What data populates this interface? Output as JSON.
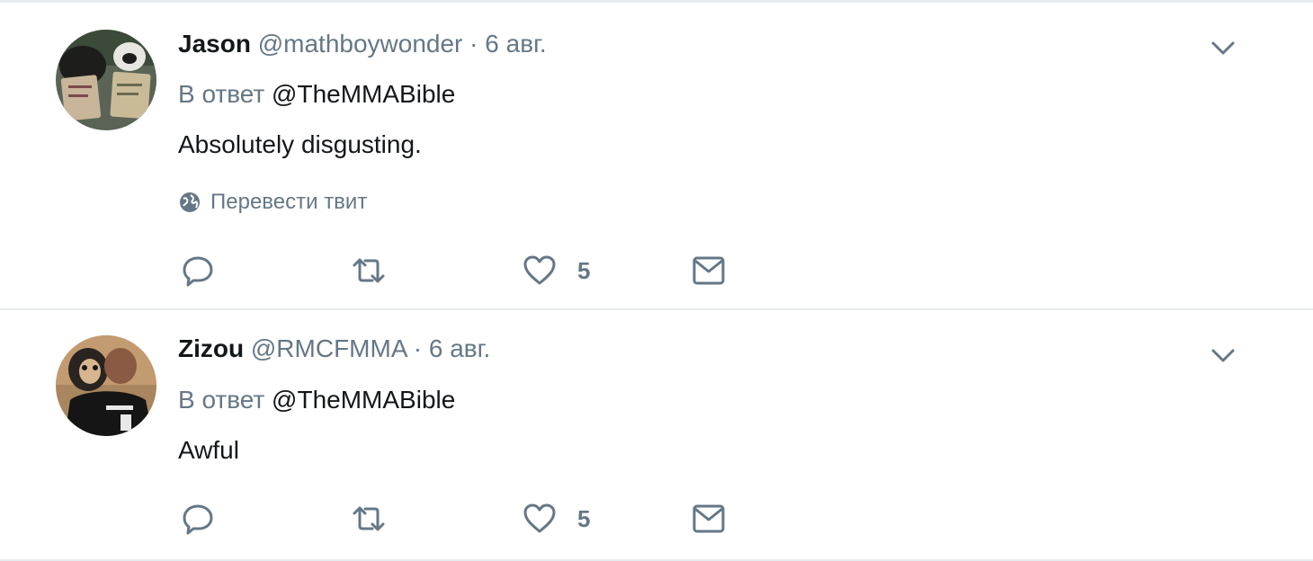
{
  "tweets": [
    {
      "name": "Jason",
      "handle": "@mathboywonder",
      "separator": "·",
      "time": "6 авг.",
      "reply_prefix": "В ответ",
      "reply_to": "@TheMMABible",
      "text": "Absolutely disgusting.",
      "translate_label": "Перевести твит",
      "like_count": "5",
      "avatar_colors": {
        "bg": "#6b6f62",
        "accent": "#c8b59a",
        "dark": "#1d1d1b"
      }
    },
    {
      "name": "Zizou",
      "handle": "@RMCFMMA",
      "separator": "·",
      "time": "6 авг.",
      "reply_prefix": "В ответ",
      "reply_to": "@TheMMABible",
      "text": "Awful",
      "like_count": "5",
      "avatar_colors": {
        "bg": "#a9865f",
        "accent": "#d7b58e",
        "dark": "#151515"
      }
    }
  ],
  "icons": {
    "caret": "chevron-down-icon",
    "reply": "reply-bubble-icon",
    "retweet": "retweet-icon",
    "like": "heart-icon",
    "dm": "envelope-icon",
    "globe": "globe-icon"
  },
  "colors": {
    "text": "#14171a",
    "secondary": "#657786",
    "divider": "#e6ecf0"
  }
}
